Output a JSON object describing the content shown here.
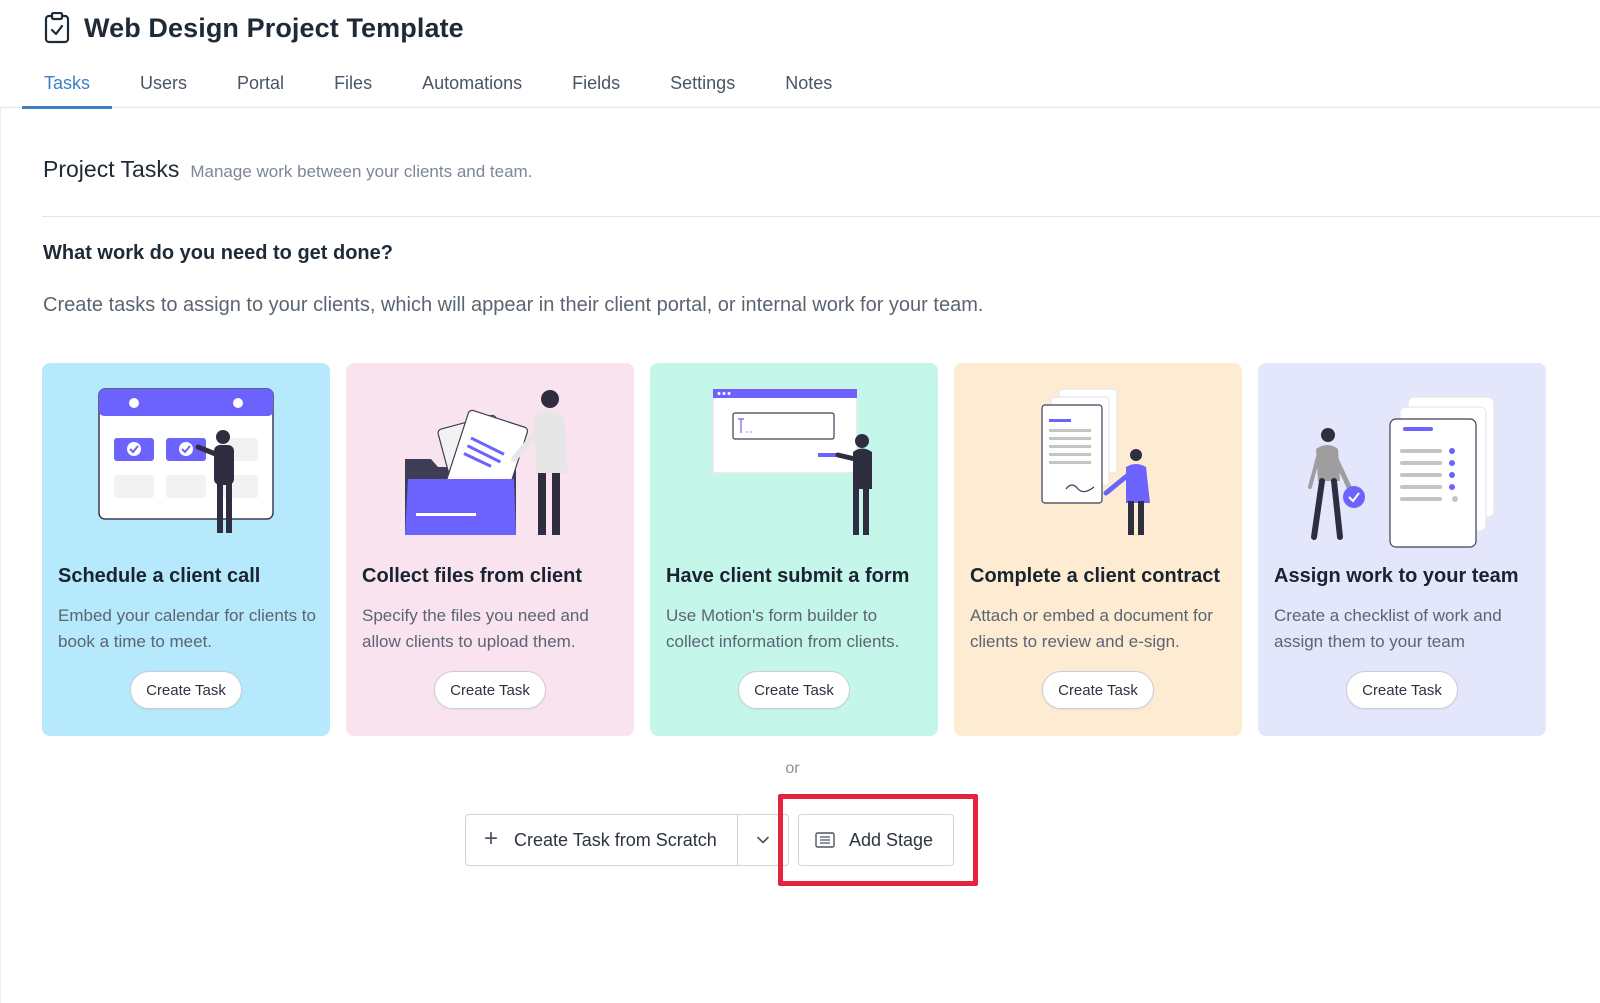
{
  "header": {
    "title": "Web Design Project Template",
    "title_icon": "clipboard-check-icon",
    "tabs": [
      "Tasks",
      "Users",
      "Portal",
      "Files",
      "Automations",
      "Fields",
      "Settings",
      "Notes"
    ],
    "active_tab": "Tasks"
  },
  "section": {
    "title": "Project Tasks",
    "subtitle": "Manage work between your clients and team."
  },
  "prompt": {
    "question": "What work do you need to get done?",
    "explanation": "Create tasks to assign to your clients, which will appear in their client portal, or internal work for your team."
  },
  "cards": [
    {
      "title": "Schedule a client call",
      "description": "Embed your calendar for clients to book a time to meet.",
      "button": "Create Task",
      "bg": "#b5e9fb",
      "illustration": "calendar-illustration"
    },
    {
      "title": "Collect files from client",
      "description": "Specify the files you need and allow clients to upload them.",
      "button": "Create Task",
      "bg": "#f9e3ef",
      "illustration": "folder-files-illustration"
    },
    {
      "title": "Have client submit a form",
      "description": "Use Motion's form builder to collect information from clients.",
      "button": "Create Task",
      "bg": "#c5f6ea",
      "illustration": "form-browser-illustration"
    },
    {
      "title": "Complete a client contract",
      "description": "Attach or embed a document for clients to review and e-sign.",
      "button": "Create Task",
      "bg": "#fdebd2",
      "illustration": "contract-sign-illustration"
    },
    {
      "title": "Assign work to your team",
      "description": "Create a checklist of work and assign them to your team",
      "button": "Create Task",
      "bg": "#e4e6fc",
      "illustration": "checklist-illustration"
    }
  ],
  "actions": {
    "or_label": "or",
    "create_scratch": "Create Task from Scratch",
    "add_stage": "Add Stage"
  },
  "colors": {
    "accent": "#3b82c4",
    "illustration_purple": "#6c63ff",
    "highlight": "#e5243b"
  }
}
